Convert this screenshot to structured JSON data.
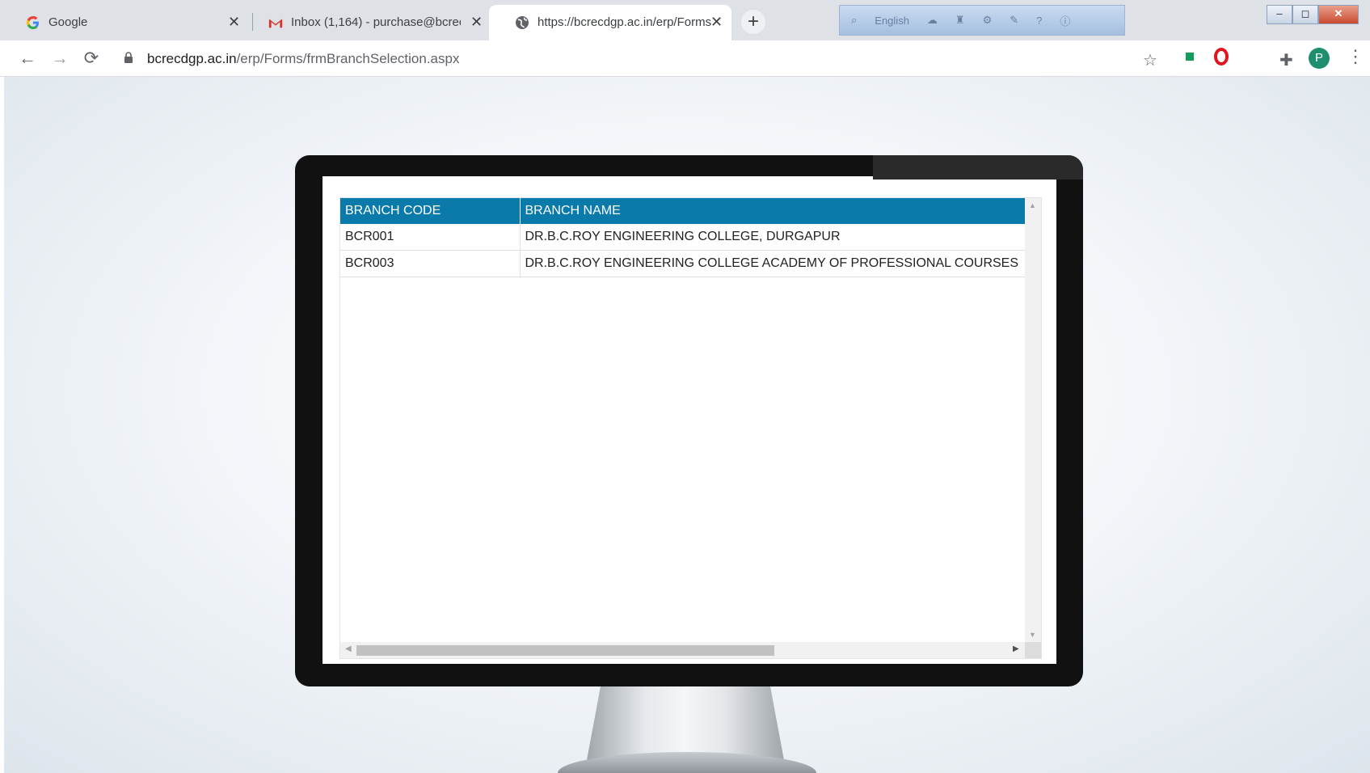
{
  "tabs": [
    {
      "title": "Google",
      "icon": "google-g-icon",
      "close": "✕"
    },
    {
      "title": "Inbox (1,164) - purchase@bcrec.a",
      "icon": "gmail-icon",
      "close": "✕"
    },
    {
      "title": "https://bcrecdgp.ac.in/erp/Forms",
      "icon": "globe-icon",
      "close": "✕",
      "active": true
    }
  ],
  "newtab_label": "+",
  "langbar": {
    "language": "English"
  },
  "window_controls": {
    "minimize": "–",
    "restore": "◻",
    "close": "✕"
  },
  "toolbar": {
    "back": "←",
    "forward": "→",
    "reload": "⟳",
    "url_host": "bcrecdgp.ac.in",
    "url_path": "/erp/Forms/frmBranchSelection.aspx",
    "star": "☆",
    "avatar_letter": "P",
    "menu": "⋮"
  },
  "grid": {
    "columns": [
      "BRANCH CODE",
      "BRANCH NAME"
    ],
    "rows": [
      {
        "code": "BCR001",
        "name": "DR.B.C.ROY ENGINEERING COLLEGE, DURGAPUR"
      },
      {
        "code": "BCR003",
        "name": "DR.B.C.ROY ENGINEERING COLLEGE ACADEMY OF PROFESSIONAL COURSES"
      }
    ],
    "header_color": "#0a7aab"
  }
}
